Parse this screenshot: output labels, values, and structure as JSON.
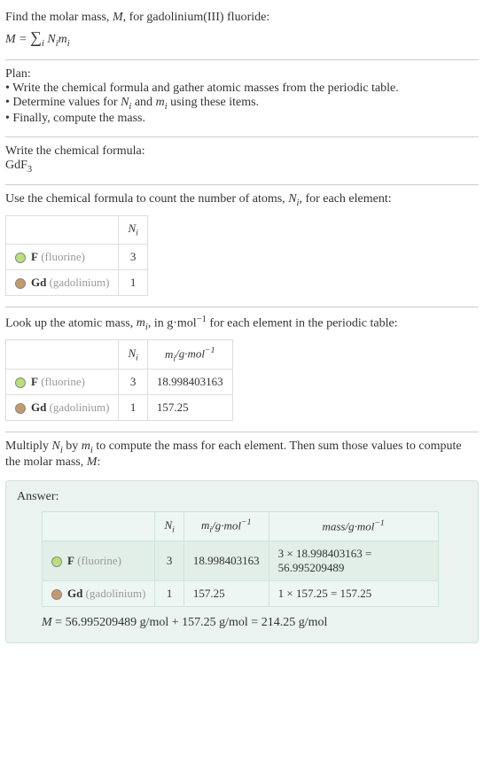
{
  "intro": {
    "line1": "Find the molar mass, M, for gadolinium(III) fluoride:",
    "formula": "M = ∑ᵢ Nᵢmᵢ"
  },
  "plan": {
    "heading": "Plan:",
    "b1": "• Write the chemical formula and gather atomic masses from the periodic table.",
    "b2": "• Determine values for Nᵢ and mᵢ using these items.",
    "b3": "• Finally, compute the mass."
  },
  "formula_step": {
    "heading": "Write the chemical formula:",
    "value": "GdF",
    "sub": "3"
  },
  "count_step": {
    "heading": "Use the chemical formula to count the number of atoms, Nᵢ, for each element:",
    "header_n": "Nᵢ",
    "rows": [
      {
        "color": "#b7e07a",
        "sym": "F",
        "name": "(fluorine)",
        "n": "3"
      },
      {
        "color": "#c49a6c",
        "sym": "Gd",
        "name": "(gadolinium)",
        "n": "1"
      }
    ]
  },
  "mass_step": {
    "heading_a": "Look up the atomic mass, mᵢ, in g·mol",
    "heading_sup": "−1",
    "heading_b": " for each element in the periodic table:",
    "header_n": "Nᵢ",
    "header_m": "mᵢ/g·mol⁻¹",
    "rows": [
      {
        "color": "#b7e07a",
        "sym": "F",
        "name": "(fluorine)",
        "n": "3",
        "m": "18.998403163"
      },
      {
        "color": "#c49a6c",
        "sym": "Gd",
        "name": "(gadolinium)",
        "n": "1",
        "m": "157.25"
      }
    ]
  },
  "multiply_step": {
    "line1": "Multiply Nᵢ by mᵢ to compute the mass for each element. Then sum those values to compute the molar mass, M:"
  },
  "answer": {
    "label": "Answer:",
    "header_n": "Nᵢ",
    "header_m": "mᵢ/g·mol⁻¹",
    "header_mass": "mass/g·mol⁻¹",
    "rows": [
      {
        "color": "#b7e07a",
        "sym": "F",
        "name": "(fluorine)",
        "n": "3",
        "m": "18.998403163",
        "mass": "3 × 18.998403163 = 56.995209489"
      },
      {
        "color": "#c49a6c",
        "sym": "Gd",
        "name": "(gadolinium)",
        "n": "1",
        "m": "157.25",
        "mass": "1 × 157.25 = 157.25"
      }
    ],
    "result": "M = 56.995209489 g/mol + 157.25 g/mol = 214.25 g/mol"
  }
}
